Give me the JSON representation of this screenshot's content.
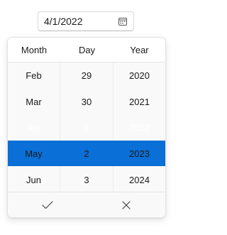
{
  "date_field": {
    "value": "4/1/2022",
    "icon": "calendar-icon"
  },
  "picker": {
    "headers": [
      "Month",
      "Day",
      "Year"
    ],
    "months": [
      "Feb",
      "Mar",
      "Apr",
      "May",
      "Jun"
    ],
    "days": [
      "29",
      "30",
      "1",
      "2",
      "3"
    ],
    "years": [
      "2020",
      "2021",
      "2022",
      "2023",
      "2024"
    ],
    "selected_index": 2,
    "accent_color": "#0a6fd6"
  },
  "footer": {
    "accept_icon": "checkmark-icon",
    "dismiss_icon": "close-icon"
  }
}
